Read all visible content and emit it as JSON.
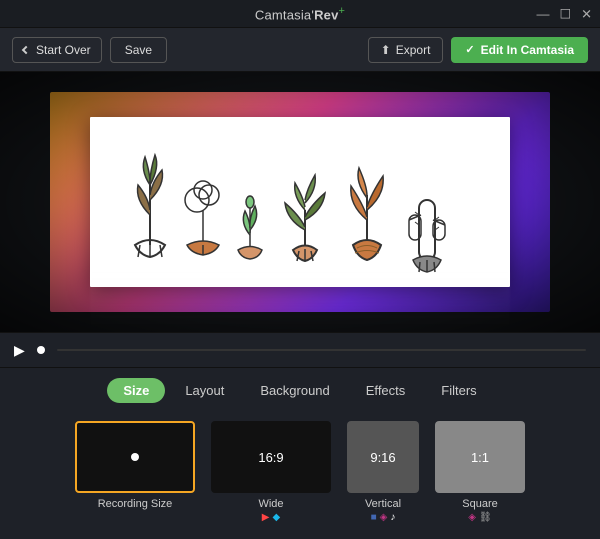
{
  "titleBar": {
    "brand": "Camtasia'",
    "rev": "Rev",
    "plus": "+",
    "title": "Camtasia'Rev+"
  },
  "windowControls": {
    "minimize": "—",
    "maximize": "☐",
    "close": "✕"
  },
  "toolbar": {
    "startOver": "Start Over",
    "save": "Save",
    "export": "Export",
    "editInCamtasia": "Edit In Camtasia"
  },
  "controls": {
    "playIcon": "▶"
  },
  "tabs": [
    {
      "id": "size",
      "label": "Size",
      "active": true
    },
    {
      "id": "layout",
      "label": "Layout",
      "active": false
    },
    {
      "id": "background",
      "label": "Background",
      "active": false
    },
    {
      "id": "effects",
      "label": "Effects",
      "active": false
    },
    {
      "id": "filters",
      "label": "Filters",
      "active": false
    }
  ],
  "presets": [
    {
      "id": "recording",
      "name": "Recording Size",
      "type": "recording",
      "selected": true,
      "icons": []
    },
    {
      "id": "wide",
      "name": "Wide",
      "type": "wide",
      "label": "16:9",
      "selected": false,
      "icons": [
        "yt",
        "vimeo"
      ]
    },
    {
      "id": "vertical",
      "name": "Vertical",
      "type": "vertical",
      "label": "9:16",
      "selected": false,
      "icons": [
        "fb",
        "ig",
        "tiktok"
      ]
    },
    {
      "id": "square",
      "name": "Square",
      "type": "square",
      "label": "1:1",
      "selected": false,
      "icons": [
        "ig",
        "link"
      ]
    }
  ],
  "colors": {
    "accent": "#6dbf67",
    "selected": "#f5a623",
    "bg": "#1e2128"
  }
}
